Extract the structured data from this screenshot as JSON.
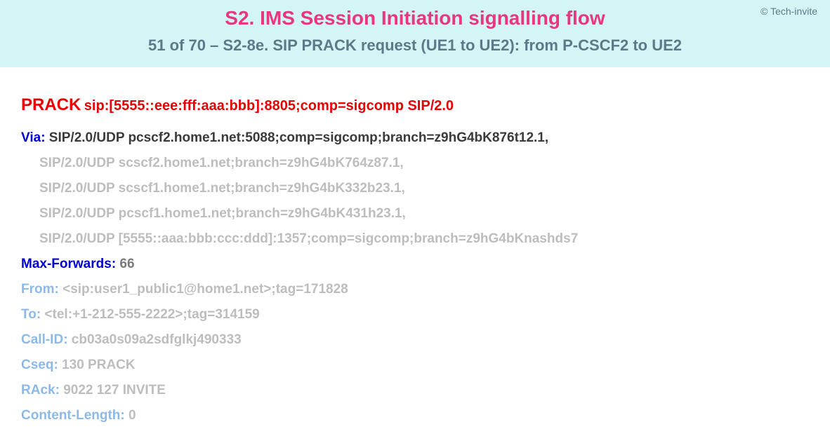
{
  "copyright": "© Tech-invite",
  "header": {
    "title": "S2. IMS Session Initiation signalling flow",
    "subtitle": "51 of 70 – S2-8e. SIP PRACK request (UE1 to UE2): from P-CSCF2 to UE2"
  },
  "sip": {
    "method": "PRACK",
    "request_uri": "sip:[5555::eee:fff:aaa:bbb]:8805;comp=sigcomp SIP/2.0",
    "via": {
      "label": "Via",
      "first": "SIP/2.0/UDP pcscf2.home1.net:5088;comp=sigcomp;branch=z9hG4bK876t12.1,",
      "rest": [
        "SIP/2.0/UDP scscf2.home1.net;branch=z9hG4bK764z87.1,",
        "SIP/2.0/UDP scscf1.home1.net;branch=z9hG4bK332b23.1,",
        "SIP/2.0/UDP pcscf1.home1.net;branch=z9hG4bK431h23.1,",
        "SIP/2.0/UDP [5555::aaa:bbb:ccc:ddd]:1357;comp=sigcomp;branch=z9hG4bKnashds7"
      ]
    },
    "max_forwards": {
      "label": "Max-Forwards",
      "value": "66"
    },
    "from": {
      "label": "From",
      "value": "<sip:user1_public1@home1.net>;tag=171828"
    },
    "to": {
      "label": "To",
      "value": "<tel:+1-212-555-2222>;tag=314159"
    },
    "call_id": {
      "label": "Call-ID",
      "value": "cb03a0s09a2sdfglkj490333"
    },
    "cseq": {
      "label": "Cseq",
      "value": "130 PRACK"
    },
    "rack": {
      "label": "RAck",
      "value": "9022 127 INVITE"
    },
    "content_length": {
      "label": "Content-Length",
      "value": "0"
    }
  }
}
